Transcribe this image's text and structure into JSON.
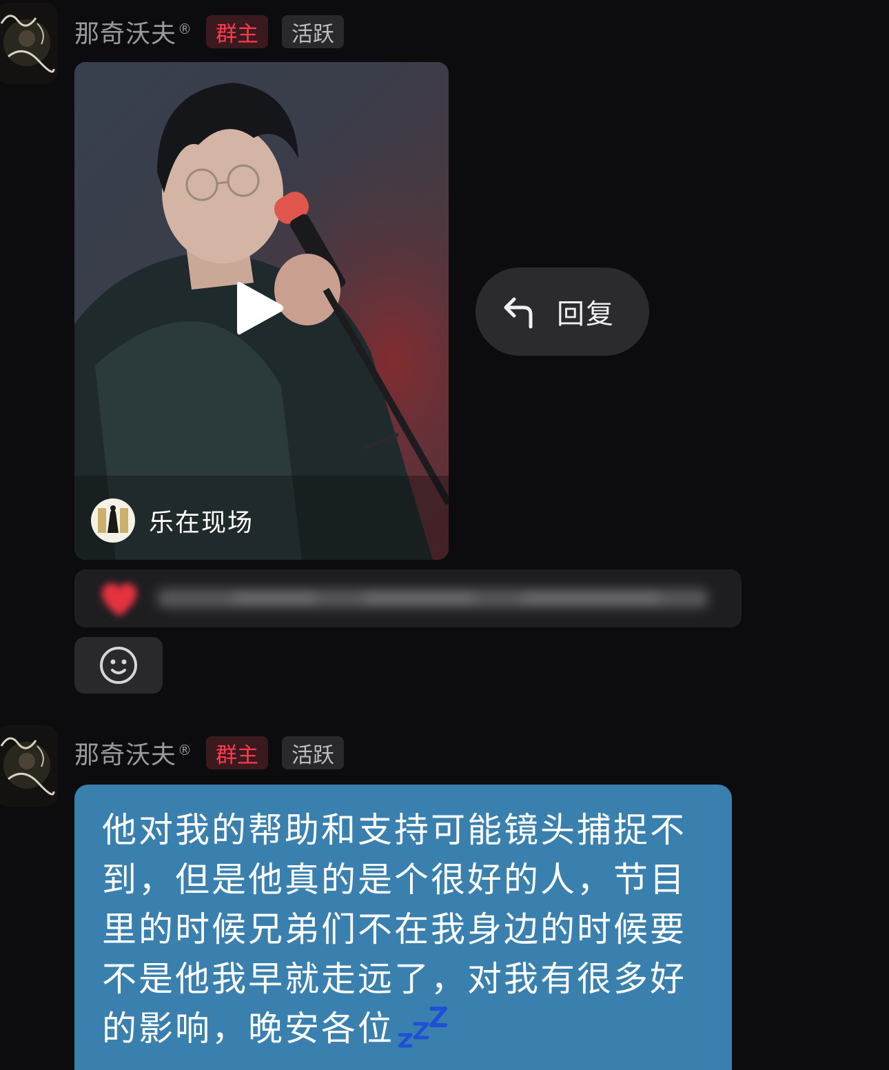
{
  "messages": [
    {
      "sender": {
        "name": "那奇沃夫",
        "mark": "®",
        "tags": {
          "owner": "群主",
          "active": "活跃"
        }
      },
      "video": {
        "source_name": "乐在现场",
        "play_icon": "play-icon"
      },
      "reply": {
        "label": "回复",
        "icon": "reply-arrow-icon"
      },
      "reaction": {
        "icon": "heart-icon",
        "blurred": true
      },
      "emoji_button": {
        "icon": "smiley-face-icon"
      }
    },
    {
      "sender": {
        "name": "那奇沃夫",
        "mark": "®",
        "tags": {
          "owner": "群主",
          "active": "活跃"
        }
      },
      "text": "他对我的帮助和支持可能镜头捕捉不到，但是他真的是个很好的人，节目里的时候兄弟们不在我身边的时候要不是他我早就走远了，对我有很多好的影响，晚安各位",
      "trailing_emoji": "zzz-sleep-icon"
    }
  ],
  "colors": {
    "background": "#0c0c0e",
    "owner_tag_text": "#ff3b4d",
    "owner_tag_bg": "#3a1a1e",
    "active_tag_bg": "#29292c",
    "bubble": "#3a80ae",
    "pill": "#2b2b2e",
    "zzz": "#1e4fd6"
  }
}
